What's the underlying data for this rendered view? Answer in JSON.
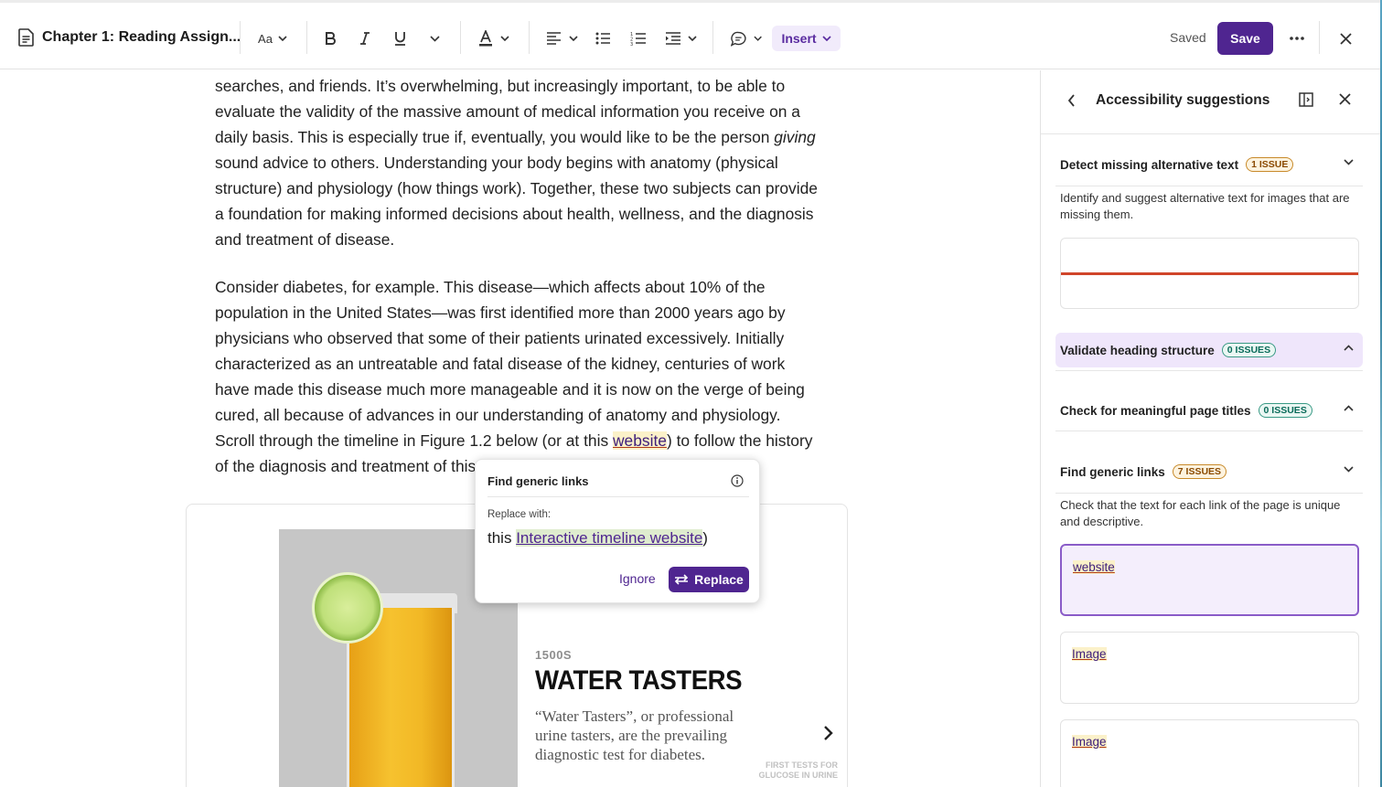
{
  "toolbar": {
    "doc_title": "Chapter 1: Reading Assign...",
    "font_size_label": "Aa",
    "insert_label": "Insert",
    "saved_label": "Saved",
    "save_label": "Save"
  },
  "document": {
    "paragraph1": "searches, and friends. It’s overwhelming, but increasingly important, to be able to evaluate the validity of the massive amount of medical information you receive on a daily basis. This is especially true if, eventually, you would like to be the person",
    "paragraph1_italic": "giving",
    "paragraph1_end": "sound advice to others. Understanding your body begins with anatomy (physical structure) and physiology (how things work). Together, these two subjects can provide a foundation for making informed decisions about health, wellness, and the diagnosis and treatment of disease.",
    "paragraph2_start": "Consider diabetes, for example. This disease—which affects about 10% of the population in the United States—was first identified more than 2000 years ago by physicians who observed that some of their patients urinated excessively. Initially characterized as an untreatable and fatal disease of the kidney, centuries of work have made this disease much more manageable and it is now on the verge of being cured, all because of advances in our understanding of anatomy and physiology. Scroll through the timeline in Figure 1.2 below (or at this",
    "paragraph2_link": "website",
    "paragraph2_end": ") to follow the history of the diagnosis and treatment of this once d"
  },
  "figure": {
    "era": "1500S",
    "title": "WATER TASTERS",
    "description": "“Water Tasters”, or professional urine tasters, are the prevailing diagnostic test for diabetes.",
    "caption": "FIRST TESTS FOR GLUCOSE IN URINE"
  },
  "popup": {
    "title": "Find generic links",
    "replace_label": "Replace with:",
    "value_prefix": "this",
    "value_link": "Interactive timeline website",
    "value_suffix": ")",
    "ignore_label": "Ignore",
    "replace_button": "Replace"
  },
  "panel": {
    "title": "Accessibility suggestions",
    "sections": [
      {
        "title": "Detect missing alternative text",
        "badge": "1 ISSUE",
        "description": "Identify and suggest alternative text for images that are missing them."
      },
      {
        "title": "Validate heading structure",
        "badge": "0 ISSUES"
      },
      {
        "title": "Check for meaningful page titles",
        "badge": "0 ISSUES"
      },
      {
        "title": "Find generic links",
        "badge": "7 ISSUES",
        "description": "Check that the text for each link of the page is unique and descriptive."
      }
    ],
    "link_items": [
      "website",
      "Image",
      "Image"
    ]
  },
  "colors": {
    "brand": "#4f2590",
    "warn_badge": "#c88a2a",
    "ok_badge": "#3a9a86",
    "error_line": "#d0452a"
  }
}
